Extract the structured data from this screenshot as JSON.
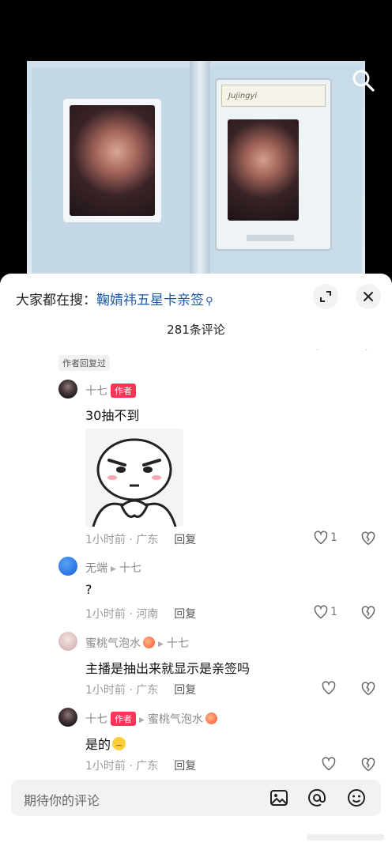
{
  "video": {
    "slab_label": "Jujingyi",
    "icons": [
      "search-icon"
    ]
  },
  "sheet": {
    "hot_search_prefix": "大家都在搜：",
    "hot_search_keyword": "鞠婧祎五星卡亲签",
    "comment_count": "281条评论",
    "author_replied_tag": "作者回复过",
    "icons": [
      "expand-icon",
      "close-icon"
    ]
  },
  "comments": [
    {
      "username": "十七",
      "badge": "作者",
      "text": "30抽不到",
      "has_sticker": true,
      "time_location": "1小时前 · 广东",
      "reply_label": "回复",
      "likes": "1"
    },
    {
      "username": "无端",
      "reply_to": "十七",
      "text": "?",
      "time_location": "1小时前 · 河南",
      "reply_label": "回复",
      "likes": "1"
    },
    {
      "username": "蜜桃气泡水",
      "reply_to": "十七",
      "text": "主播是抽出来就显示是亲签吗",
      "time_location": "1小时前 · 广东",
      "reply_label": "回复",
      "likes": ""
    },
    {
      "username": "十七",
      "badge": "作者",
      "reply_to": "蜜桃气泡水",
      "text": "是的",
      "time_location": "1小时前 · 广东",
      "reply_label": "回复",
      "likes": ""
    }
  ],
  "input": {
    "placeholder": "期待你的评论",
    "icons": [
      "image-icon",
      "at-icon",
      "emoji-icon"
    ]
  },
  "colors": {
    "accent_link": "#1e5aa8",
    "author_badge": "#ff3355"
  }
}
